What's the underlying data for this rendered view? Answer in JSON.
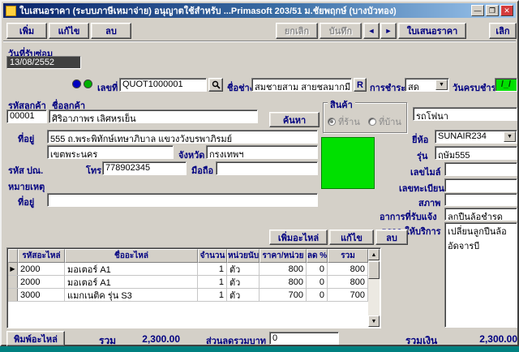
{
  "window": {
    "title": "ใบเสนอราคา (ระบบภาษีเหมาจ่าย) อนุญาตใช้สำหรับ ...Primasoft 203/51 ม.ชัยพฤกษ์ (บางบัวทอง)",
    "minimize": "—",
    "maximize": "❐",
    "close": "✕"
  },
  "toolbar": {
    "add": "เพิ่ม",
    "edit": "แก้ไข",
    "delete": "ลบ",
    "cancel": "ยกเลิก",
    "save": "บันทึก",
    "prev": "◄",
    "next": "►",
    "quotation": "ใบเสนอราคา",
    "exit": "เลิก"
  },
  "header": {
    "receive_date_label": "วันที่รับซ่อม",
    "receive_date": "13/08/2552",
    "doc_no_label": "เลขที่",
    "doc_no": "QUOT1000001",
    "technician_label": "ชื่อช่าง",
    "technician": "สมชายสาม สายชลมากมี",
    "r_button": "R",
    "payment_label": "การชำระเงิน",
    "payment": "สด",
    "due_date_label": "วันครบชำระ",
    "due_date": "/_/"
  },
  "customer": {
    "code_label": "รหัสลูกค้า",
    "name_label": "ชื่อลูกค้า",
    "code": "00001",
    "name": "ศิริอาภาพร เลิศหรูเย็น",
    "search": "ค้นหา",
    "address_label": "ที่อยู่",
    "address1": "555 ถ.พระพิทักษ์เทษาภิบาล แขวงวังบูรพาภิรมย์",
    "address2": "เขตพระนคร",
    "province_label": "จังหวัด",
    "province": "กรุงเทพฯ",
    "postal_label": "รหัส ปณ.",
    "phone_label": "โทร",
    "phone": "778902345",
    "mobile_label": "มือถือ",
    "mobile": "",
    "note_label": "หมายเหตุ",
    "note_address_label": "ที่อยู่",
    "note_address": ""
  },
  "product": {
    "group_label": "สินค้า",
    "option_shop": "ที่ร้าน",
    "option_home": "ที่บ้าน",
    "vehicle": "รถโฟนา",
    "brand_label": "ยี่ห้อ",
    "brand": "SUNAIR234",
    "model_label": "รุ่น",
    "model": "ฤษัม555",
    "mileage_label": "เลขไมล์",
    "mileage": "",
    "plate_label": "เลขทะเบียน",
    "plate": "",
    "condition_label": "สภาพ",
    "condition": "",
    "symptom_label": "อาการที่รับแจ้ง",
    "symptom": "ลูกปืนล้อชำรุด",
    "service_label": "ตรวจ-ให้บริการ",
    "service": "เปลี่ยนลูกปืนล้อ\nอัดจารบี"
  },
  "parts": {
    "add": "เพิ่มอะไหล่",
    "edit": "แก้ไข",
    "delete": "ลบ",
    "selector_marker": "▶",
    "scrollbar": {
      "up": "▲",
      "down": "▼"
    },
    "columns": [
      "รหัสอะไหล่",
      "ชื่ออะไหล่",
      "จำนวน",
      "หน่วยนับ",
      "ราคา/หน่วย",
      "ลด %",
      "รวม"
    ],
    "rows": [
      [
        "2000",
        "มอเตอร์ A1",
        "1",
        "ตัว",
        "800",
        "0",
        "800"
      ],
      [
        "2000",
        "มอเตอร์ A1",
        "1",
        "ตัว",
        "800",
        "0",
        "800"
      ],
      [
        "3000",
        "แมกเนติค รุ่น S3",
        "1",
        "ตัว",
        "700",
        "0",
        "700"
      ]
    ]
  },
  "footer": {
    "print": "พิมพ์อะไหล่",
    "total_label": "รวม",
    "total": "2,300.00",
    "discount_label": "ส่วนลดรวมบาท",
    "discount": "0",
    "grand_total_label": "รวมเงิน",
    "grand_total": "2,300.00"
  },
  "colors": {
    "accent": "#000080",
    "highlight_green": "#00e000",
    "desktop": "#008080"
  }
}
